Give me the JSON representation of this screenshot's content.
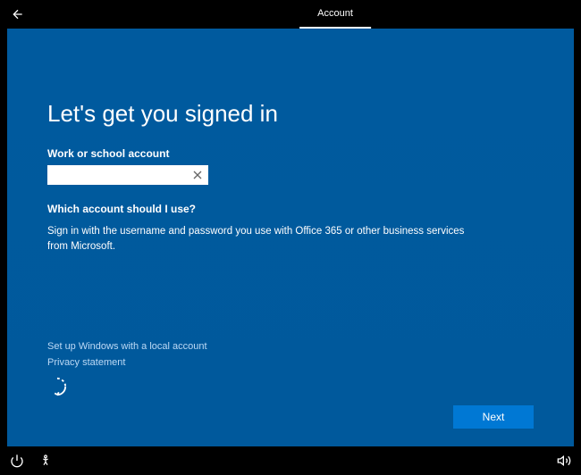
{
  "header": {
    "tabs": {
      "account": "Account"
    }
  },
  "main": {
    "title": "Let's get you signed in",
    "field_label": "Work or school account",
    "input_value": "",
    "help_heading": "Which account should I use?",
    "help_text": "Sign in with the username and password you use with Office 365 or other business services from Microsoft."
  },
  "links": {
    "local_account": "Set up Windows with a local account",
    "privacy": "Privacy statement"
  },
  "buttons": {
    "next": "Next"
  }
}
